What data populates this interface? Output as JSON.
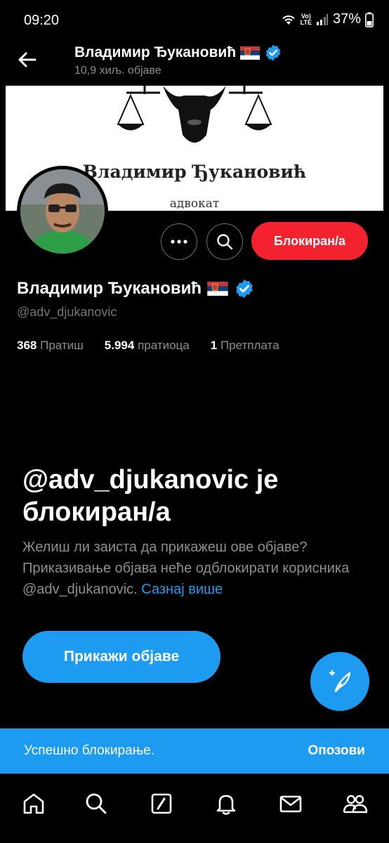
{
  "status_bar": {
    "time": "09:20",
    "volte_line1": "Vo)",
    "volte_line2": "LTE",
    "battery": "37%"
  },
  "header": {
    "name": "Владимир Ђукановић",
    "posts_count": "10,9 хиљ. објаве"
  },
  "banner": {
    "title": "Владимир Ђукановић",
    "subtitle": "адвокат"
  },
  "actions": {
    "blocked_label": "Блокиран/а"
  },
  "profile": {
    "name": "Владимир Ђукановић",
    "handle": "@adv_djukanovic",
    "stats": [
      {
        "value": "368",
        "label": "Пратиш"
      },
      {
        "value": "5.994",
        "label": "пратиоца"
      },
      {
        "value": "1",
        "label": "Претплата"
      }
    ]
  },
  "blocked_notice": {
    "title": "@adv_djukanovic je блокиран/а",
    "description": "Желиш ли заиста да прикажеш ове објаве? Приказивање објава неће одблокирати корисника @adv_djukanovic.",
    "learn_more": "Сазнај више",
    "show_button": "Прикажи објаве"
  },
  "toast": {
    "message": "Успешно блокирање.",
    "undo": "Опозови"
  },
  "colors": {
    "accent": "#1d9bf0",
    "danger": "#f4212e",
    "background": "#000000"
  },
  "icons": [
    "back-arrow-icon",
    "serbian-flag-icon",
    "verified-badge-icon",
    "more-icon",
    "search-icon",
    "compose-icon",
    "home-icon",
    "grok-icon",
    "bell-icon",
    "mail-icon",
    "communities-icon"
  ]
}
